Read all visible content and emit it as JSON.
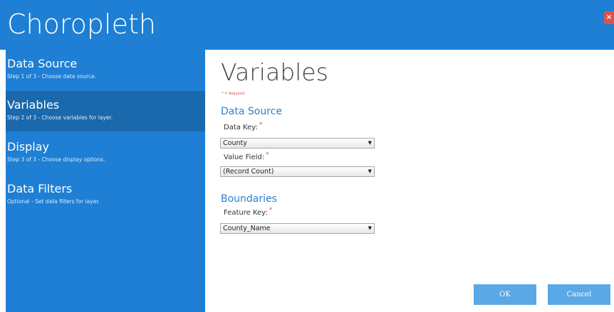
{
  "window": {
    "title": "Choropleth",
    "close_icon": "×"
  },
  "sidebar": {
    "items": [
      {
        "label": "Data Source",
        "subtitle": "Step 1 of 3 - Choose data source.",
        "active": false
      },
      {
        "label": "Variables",
        "subtitle": "Step 2 of 3 - Choose variables for layer.",
        "active": true
      },
      {
        "label": "Display",
        "subtitle": "Step 3 of 3 - Choose display options.",
        "active": false
      },
      {
        "label": "Data Filters",
        "subtitle": "Optional - Set data filters for layer.",
        "active": false
      }
    ]
  },
  "main": {
    "title": "Variables",
    "required_note": "* = Required",
    "sections": [
      {
        "heading": "Data Source",
        "fields": [
          {
            "label": "Data Key:",
            "required_mark": "*",
            "value": "County"
          },
          {
            "label": "Value Field:",
            "required_mark": "*",
            "value": "(Record Count)"
          }
        ]
      },
      {
        "heading": "Boundaries",
        "fields": [
          {
            "label": "Feature Key:",
            "required_mark": "*",
            "value": "County_Name"
          }
        ]
      }
    ],
    "dropdown_arrow": "▼"
  },
  "buttons": {
    "ok": "OK",
    "cancel": "Cancel"
  },
  "colors": {
    "accent": "#1e7fd4",
    "active_nav": "#1a69ad",
    "button": "#5aa9e6",
    "required": "#d9534f"
  }
}
